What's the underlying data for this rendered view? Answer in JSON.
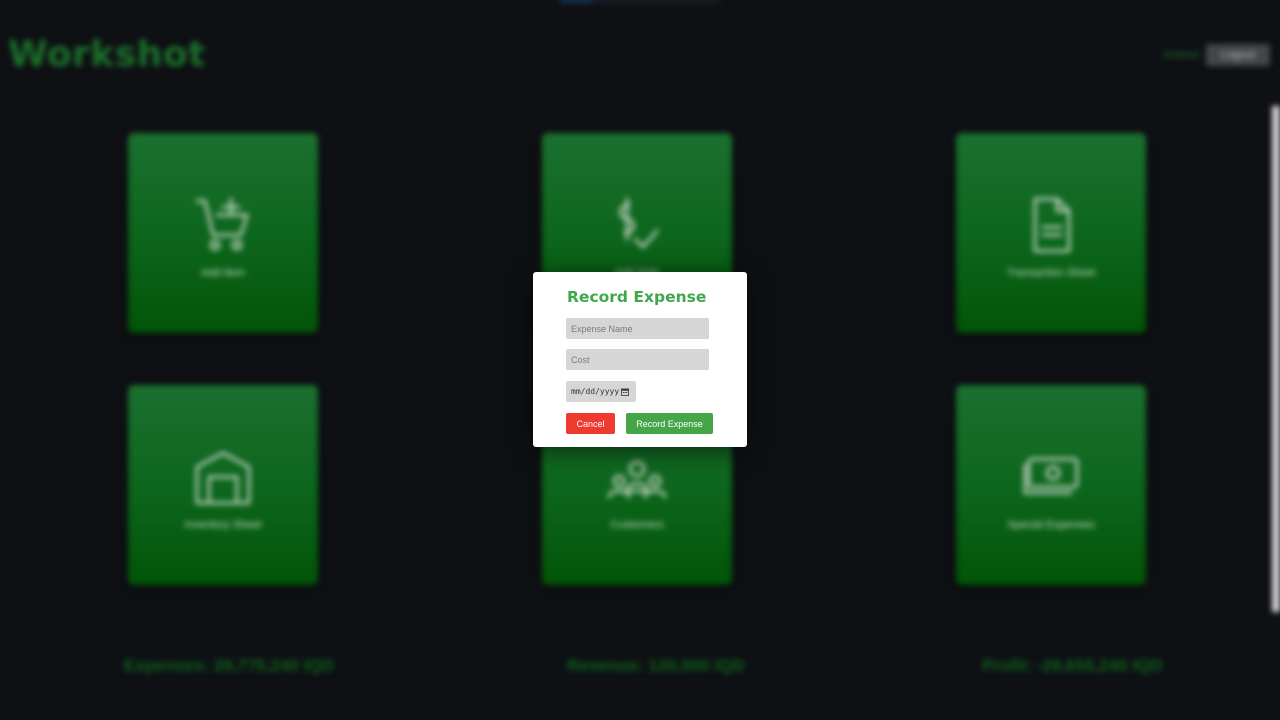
{
  "app": {
    "brand": "Workshot",
    "user_name": "Andrew",
    "logout_label": "Logout"
  },
  "dashboard": {
    "tiles": [
      {
        "label": "Add Item",
        "icon": "cart-plus-icon"
      },
      {
        "label": "Add Sale",
        "icon": "dollar-check-icon"
      },
      {
        "label": "Transaction Sheet",
        "icon": "document-icon"
      },
      {
        "label": "Inventory Sheet",
        "icon": "warehouse-icon"
      },
      {
        "label": "Customers",
        "icon": "users-icon"
      },
      {
        "label": "Special Expenses",
        "icon": "money-icon"
      }
    ],
    "stats": {
      "expenses": "Expenses: 28,775,240 IQD",
      "revenue": "Revenue: 120,000 IQD",
      "profit": "Profit: -28,655,240 IQD"
    }
  },
  "modal": {
    "title": "Record Expense",
    "expense_name_placeholder": "Expense Name",
    "cost_placeholder": "Cost",
    "date_placeholder": "mm/dd/yyyy",
    "cancel_label": "Cancel",
    "submit_label": "Record Expense"
  },
  "colors": {
    "brand_green": "#1f7a2e",
    "tile_gradient_top": "#1e7a34",
    "tile_gradient_bottom": "#035c08",
    "modal_title": "#3ea84a",
    "cancel_red": "#ee3a2f",
    "submit_green": "#45a648"
  }
}
